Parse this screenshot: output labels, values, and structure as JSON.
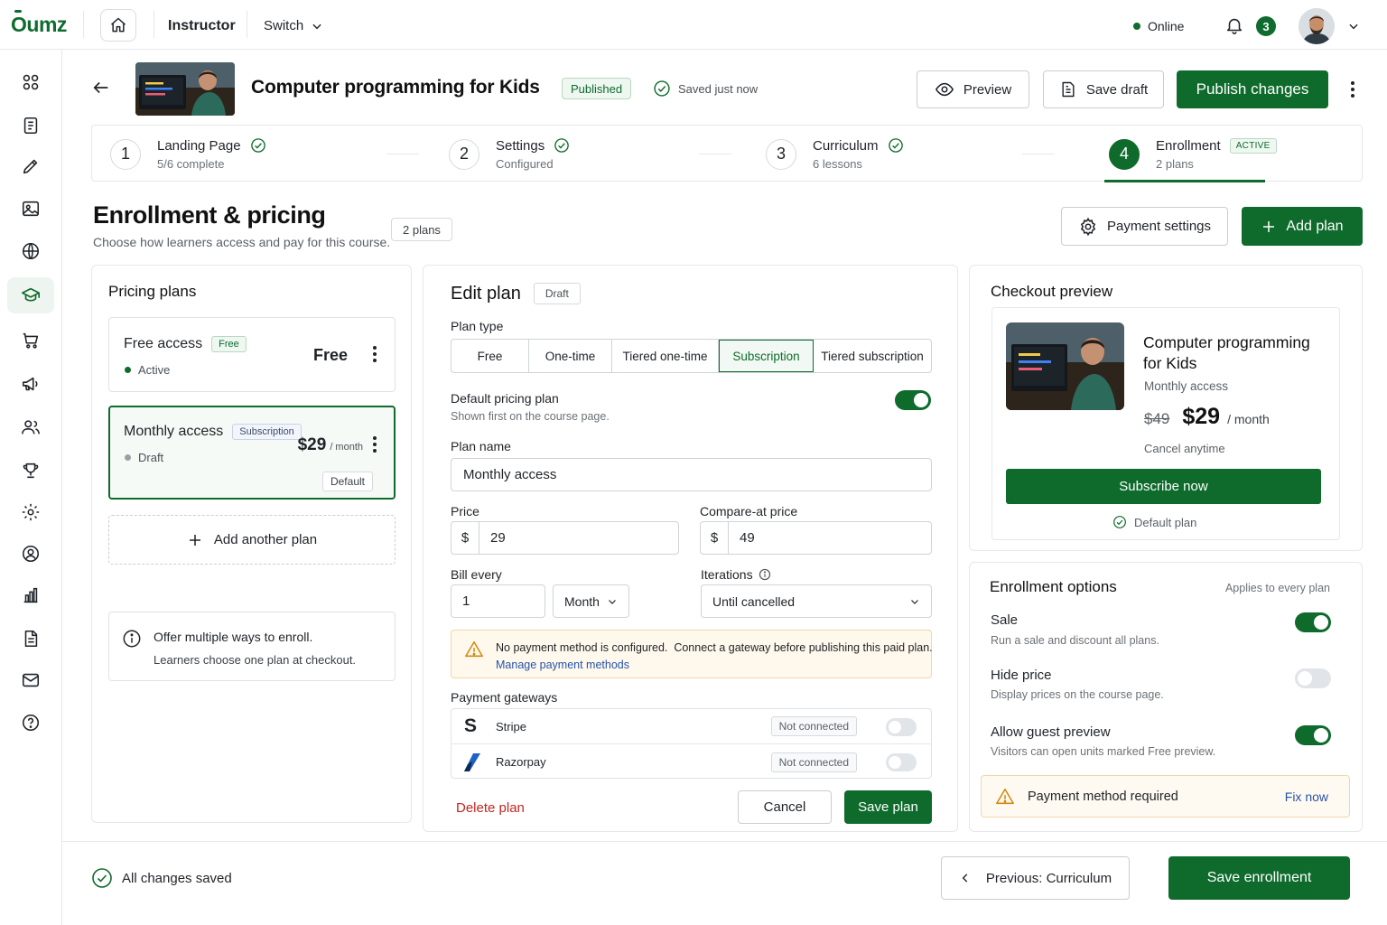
{
  "brand": {
    "logo": "Oumz",
    "accent": "#0e6b2c"
  },
  "topbar": {
    "role": "Instructor",
    "switch_label": "Switch",
    "status": "Online",
    "notifications": "3",
    "icons": [
      "home-icon",
      "bell-icon",
      "chevron-down-icon"
    ]
  },
  "sidebar": {
    "items": [
      {
        "name": "dashboard-icon"
      },
      {
        "name": "courses-icon"
      },
      {
        "name": "edit-icon"
      },
      {
        "name": "media-icon"
      },
      {
        "name": "globe-icon"
      },
      {
        "name": "academy-icon",
        "active": true
      },
      {
        "name": "cart-icon"
      },
      {
        "name": "megaphone-icon"
      },
      {
        "name": "users-icon"
      },
      {
        "name": "trophy-icon"
      },
      {
        "name": "gear-icon"
      },
      {
        "name": "profile-icon"
      },
      {
        "name": "analytics-icon"
      },
      {
        "name": "document-icon"
      },
      {
        "name": "mail-icon"
      },
      {
        "name": "help-icon"
      }
    ]
  },
  "course": {
    "title": "Computer programming for Kids",
    "status_badge": "Published",
    "saved_status": "Saved just now"
  },
  "header_actions": {
    "preview": "Preview",
    "save_draft": "Save draft",
    "publish": "Publish changes"
  },
  "stepper": {
    "steps": [
      {
        "num": "1",
        "title": "Landing Page",
        "sub": "5/6 complete",
        "done": true
      },
      {
        "num": "2",
        "title": "Settings",
        "sub": "Configured",
        "done": true
      },
      {
        "num": "3",
        "title": "Curriculum",
        "sub": "6 lessons",
        "done": true
      },
      {
        "num": "4",
        "title": "Enrollment",
        "sub": "2 plans",
        "tag": "ACTIVE",
        "active": true
      }
    ]
  },
  "section": {
    "title": "Enrollment & pricing",
    "subtitle": "Choose how learners access and pay for this course.",
    "plans_count": "2 plans",
    "payment_settings": "Payment settings",
    "add_plan": "Add plan"
  },
  "plans": {
    "title": "Pricing plans",
    "items": [
      {
        "name": "Free access",
        "tag": "Free",
        "status": "Active",
        "price": "Free"
      },
      {
        "name": "Monthly access",
        "tag": "Subscription",
        "status": "Draft",
        "price": "$29",
        "period": "/ month",
        "default_label": "Default"
      }
    ],
    "add_another": "Add another plan",
    "note_title": "Offer multiple ways to enroll.",
    "note_body": "Learners choose one plan at checkout."
  },
  "edit_plan": {
    "title": "Edit plan",
    "badge": "Draft",
    "plan_type_label": "Plan type",
    "plan_types": [
      "Free",
      "One-time",
      "Tiered one-time",
      "Subscription",
      "Tiered subscription"
    ],
    "selected_type": "Subscription",
    "default_label": "Default pricing plan",
    "default_sub": "Shown first on the course page.",
    "default_on": true,
    "plan_name_label": "Plan name",
    "plan_name": "Monthly access",
    "price_label": "Price",
    "currency": "$",
    "price": "29",
    "compare_label": "Compare-at price",
    "compare_price": "49",
    "bill_label": "Bill every",
    "bill_value": "1",
    "bill_unit": "Month",
    "iterations_label": "Iterations",
    "iterations_value": "Until cancelled",
    "warning": "No payment method is configured.  Connect a gateway before publishing this paid plan.",
    "warning_link": "Manage payment methods",
    "gateways_label": "Payment gateways",
    "gateways": [
      {
        "name": "Stripe",
        "status": "Not connected"
      },
      {
        "name": "Razorpay",
        "status": "Not connected"
      }
    ],
    "delete": "Delete plan",
    "cancel": "Cancel",
    "save": "Save plan"
  },
  "checkout": {
    "title": "Checkout preview",
    "course_title": "Computer programming for Kids",
    "plan": "Monthly access",
    "old_price": "$49",
    "price": "$29",
    "period": "/ month",
    "note": "Cancel anytime",
    "button": "Subscribe now",
    "default_note": "Default plan"
  },
  "options": {
    "title": "Enrollment options",
    "applies": "Applies to every plan",
    "items": [
      {
        "title": "Sale",
        "sub": "Run a sale and discount all plans.",
        "on": true
      },
      {
        "title": "Hide price",
        "sub": "Display prices on the course page.",
        "on": false
      },
      {
        "title": "Allow guest preview",
        "sub": "Visitors can open units marked Free preview.",
        "on": true
      }
    ],
    "required": "Payment method required",
    "fix": "Fix now"
  },
  "footer": {
    "status": "All changes saved",
    "previous": "Previous: Curriculum",
    "save": "Save enrollment"
  }
}
